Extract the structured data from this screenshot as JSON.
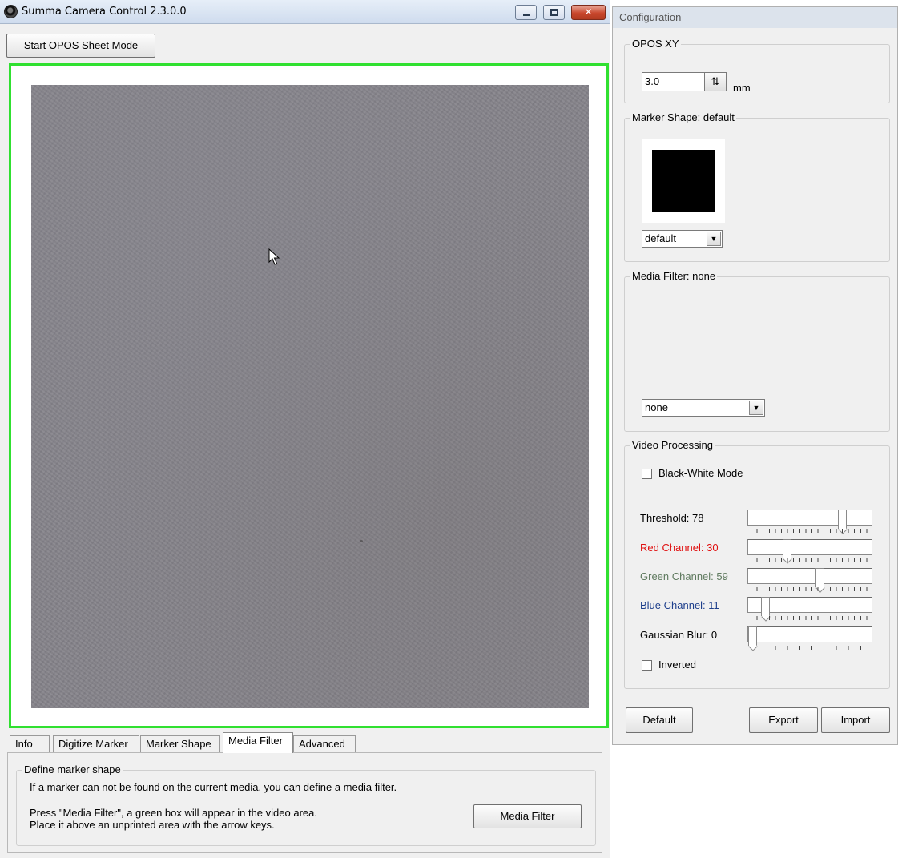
{
  "main_window": {
    "title": "Summa Camera Control 2.3.0.0",
    "start_button": "Start OPOS Sheet Mode",
    "tabs": [
      {
        "label": "Info",
        "active": false
      },
      {
        "label": "Digitize Marker",
        "active": false
      },
      {
        "label": "Marker Shape",
        "active": false
      },
      {
        "label": "Media Filter",
        "active": true
      },
      {
        "label": "Advanced",
        "active": false
      }
    ],
    "panel": {
      "group_title": "Define marker shape",
      "line1": "If a marker can not be found on the current media, you can define a media filter.",
      "line2": "Press \"Media Filter\", a green box will appear in the video area.",
      "line3": "Place it above an unprinted area with the arrow keys.",
      "button": "Media Filter"
    },
    "icons": {
      "app": "summa-camera-icon",
      "minimize": "minimize-icon",
      "maximize": "maximize-icon",
      "close": "close-icon",
      "cursor": "mouse-pointer-icon"
    },
    "colors": {
      "video_border": "#30e030",
      "video_background": "#85838a",
      "close_button": "#c9472d"
    }
  },
  "config": {
    "title": "Configuration",
    "opos": {
      "legend": "OPOS XY",
      "value": "3.0",
      "unit": "mm"
    },
    "marker_shape": {
      "legend": "Marker Shape: default",
      "selected": "default"
    },
    "media_filter": {
      "legend": "Media Filter: none",
      "selected": "none"
    },
    "video_processing": {
      "legend": "Video Processing",
      "black_white_label": "Black-White Mode",
      "black_white_checked": false,
      "sliders": [
        {
          "label": "Threshold: 78",
          "value": 78,
          "max": 100,
          "color": "#000000"
        },
        {
          "label": "Red Channel: 30",
          "value": 30,
          "max": 100,
          "color": "#e01010"
        },
        {
          "label": "Green Channel: 59",
          "value": 59,
          "max": 100,
          "color": "#5f7a5f"
        },
        {
          "label": "Blue Channel: 11",
          "value": 11,
          "max": 100,
          "color": "#1e3f8c"
        },
        {
          "label": "Gaussian Blur: 0",
          "value": 0,
          "max": 10,
          "color": "#000000"
        }
      ],
      "inverted_label": "Inverted",
      "inverted_checked": false
    },
    "buttons": {
      "default": "Default",
      "export": "Export",
      "import": "Import"
    }
  }
}
